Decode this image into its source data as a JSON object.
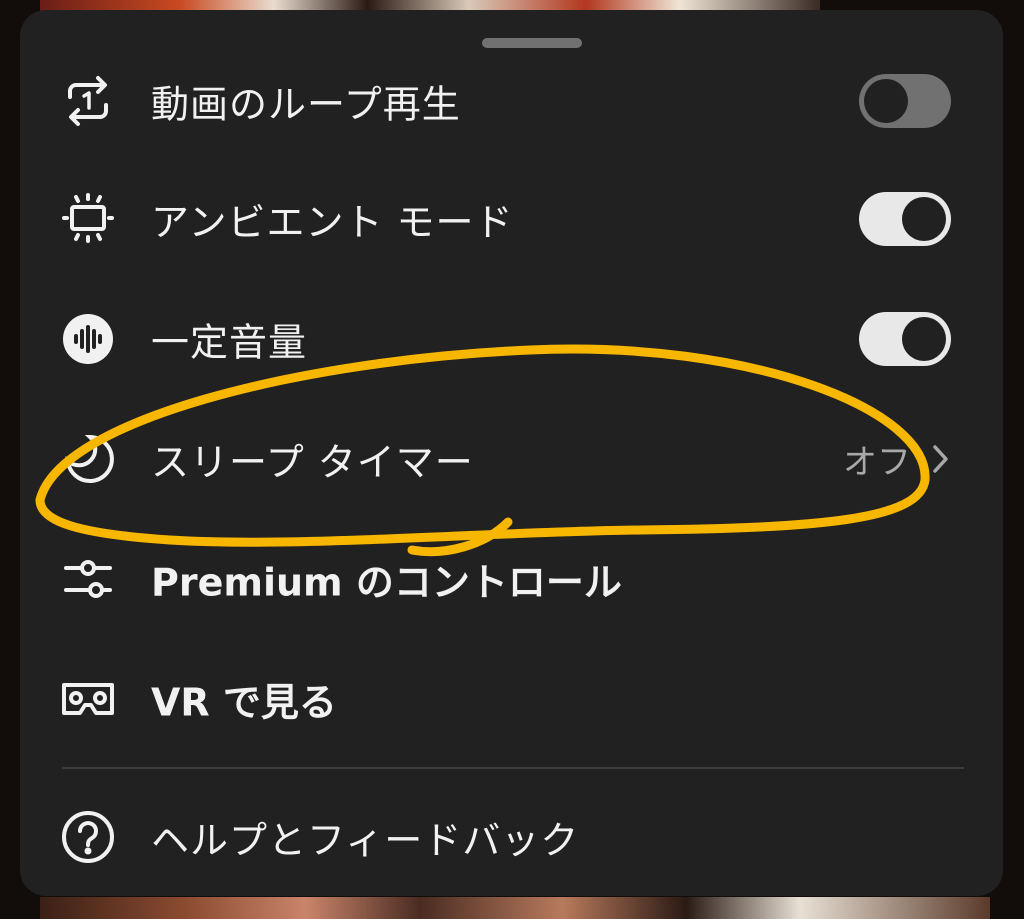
{
  "menu": {
    "items": [
      {
        "label": "動画のループ再生",
        "icon": "loop-one-icon",
        "toggle": "off"
      },
      {
        "label": "アンビエント モード",
        "icon": "ambient-mode-icon",
        "toggle": "on"
      },
      {
        "label": "一定音量",
        "icon": "stable-volume-icon",
        "toggle": "on"
      },
      {
        "label": "スリープ タイマー",
        "icon": "sleep-timer-icon",
        "value": "オフ"
      },
      {
        "label": "Premium のコントロール",
        "icon": "sliders-icon"
      },
      {
        "label": "VR で見る",
        "icon": "vr-headset-icon"
      },
      {
        "label": "ヘルプとフィードバック",
        "icon": "help-icon"
      }
    ]
  },
  "colors": {
    "sheet_bg": "#212121",
    "text": "#f1f1f1",
    "muted_text": "#a8a8a8",
    "annotation": "#f7b600"
  }
}
